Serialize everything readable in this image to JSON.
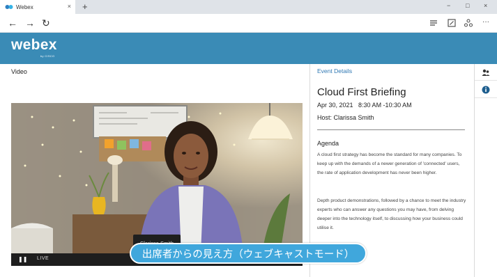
{
  "browser": {
    "tab_title": "Webex",
    "tab_close": "×",
    "new_tab": "+",
    "win_minimize": "−",
    "win_maximize": "□",
    "win_close": "×",
    "back": "←",
    "forward": "→",
    "refresh": "↻",
    "more": "···"
  },
  "app": {
    "brand": "webex",
    "brand_sub": "by CISCO"
  },
  "video_panel": {
    "label": "Video",
    "presenter_name": "Clarissa Smith",
    "pause": "❚❚",
    "live": "LIVE"
  },
  "callout": {
    "text": "出席者からの見え方（ウェブキャストモード）"
  },
  "event": {
    "tab_label": "Event Details",
    "title": "Cloud First Briefing",
    "date": "Apr 30, 2021   8:30 AM -10:30 AM",
    "host": "Host: Clarissa Smith",
    "agenda_heading": "Agenda",
    "agenda_p1": "A cloud first strategy has become the standard for many companies. To keep up with the demands of a newer generation of 'connected' users, the rate of application development has never been higher.",
    "agenda_p2": "Depth product demonstrations, followed by a chance to meet the industry experts who can answer any questions you may have, from delving deeper into the technology itself, to discussing how your business could utilise it."
  },
  "colors": {
    "brand_blue": "#3a8bb6",
    "callout_blue": "#40a7dc",
    "link_blue": "#2f78b3"
  }
}
